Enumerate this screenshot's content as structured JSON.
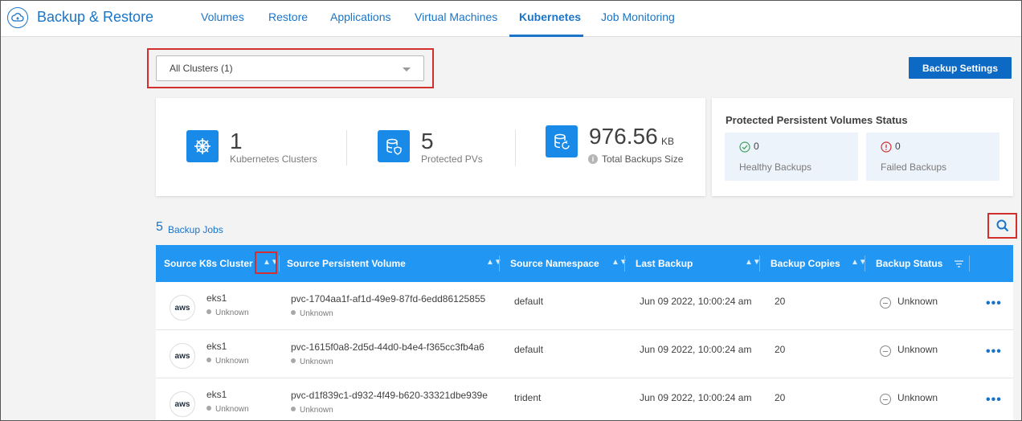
{
  "header": {
    "app_title": "Backup & Restore",
    "tabs": [
      {
        "label": "Volumes"
      },
      {
        "label": "Restore"
      },
      {
        "label": "Applications"
      },
      {
        "label": "Virtual Machines"
      },
      {
        "label": "Kubernetes"
      },
      {
        "label": "Job Monitoring"
      }
    ],
    "active_tab": "Kubernetes"
  },
  "cluster_select": {
    "value": "All Clusters (1)"
  },
  "backup_settings_label": "Backup Settings",
  "stats": {
    "clusters": {
      "value": "1",
      "label": "Kubernetes Clusters"
    },
    "pvs": {
      "value": "5",
      "label": "Protected PVs"
    },
    "size": {
      "value": "976.56",
      "unit": "KB",
      "label": "Total Backups Size"
    }
  },
  "status": {
    "title": "Protected Persistent Volumes Status",
    "healthy": {
      "count": "0",
      "label": "Healthy Backups"
    },
    "failed": {
      "count": "0",
      "label": "Failed Backups"
    }
  },
  "jobs": {
    "count": "5",
    "label": "Backup Jobs"
  },
  "table": {
    "columns": [
      "Source K8s Cluster",
      "Source Persistent Volume",
      "Source Namespace",
      "Last Backup",
      "Backup Copies",
      "Backup Status"
    ],
    "rows": [
      {
        "cluster": "eks1",
        "cluster_state": "Unknown",
        "volume": "pvc-1704aa1f-af1d-49e9-87fd-6edd86125855",
        "volume_state": "Unknown",
        "namespace": "default",
        "last_backup": "Jun 09 2022, 10:00:24 am",
        "copies": "20",
        "status": "Unknown"
      },
      {
        "cluster": "eks1",
        "cluster_state": "Unknown",
        "volume": "pvc-1615f0a8-2d5d-44d0-b4e4-f365cc3fb4a6",
        "volume_state": "Unknown",
        "namespace": "default",
        "last_backup": "Jun 09 2022, 10:00:24 am",
        "copies": "20",
        "status": "Unknown"
      },
      {
        "cluster": "eks1",
        "cluster_state": "Unknown",
        "volume": "pvc-d1f839c1-d932-4f49-b620-33321dbe939e",
        "volume_state": "Unknown",
        "namespace": "trident",
        "last_backup": "Jun 09 2022, 10:00:24 am",
        "copies": "20",
        "status": "Unknown"
      }
    ],
    "provider_badge": "aws",
    "more_label": "•••"
  },
  "colors": {
    "brand": "#1a74c7",
    "table_header": "#2196f3",
    "primary_button": "#0d6ac4",
    "highlight": "#d32f2f"
  },
  "icons": [
    "cloud-restore-icon",
    "kubernetes-wheel-icon",
    "database-shield-icon",
    "database-restore-icon",
    "info-icon",
    "check-circle-icon",
    "error-circle-icon",
    "search-icon",
    "sort-icon",
    "filter-icon",
    "minus-circle-icon",
    "more-icon"
  ]
}
